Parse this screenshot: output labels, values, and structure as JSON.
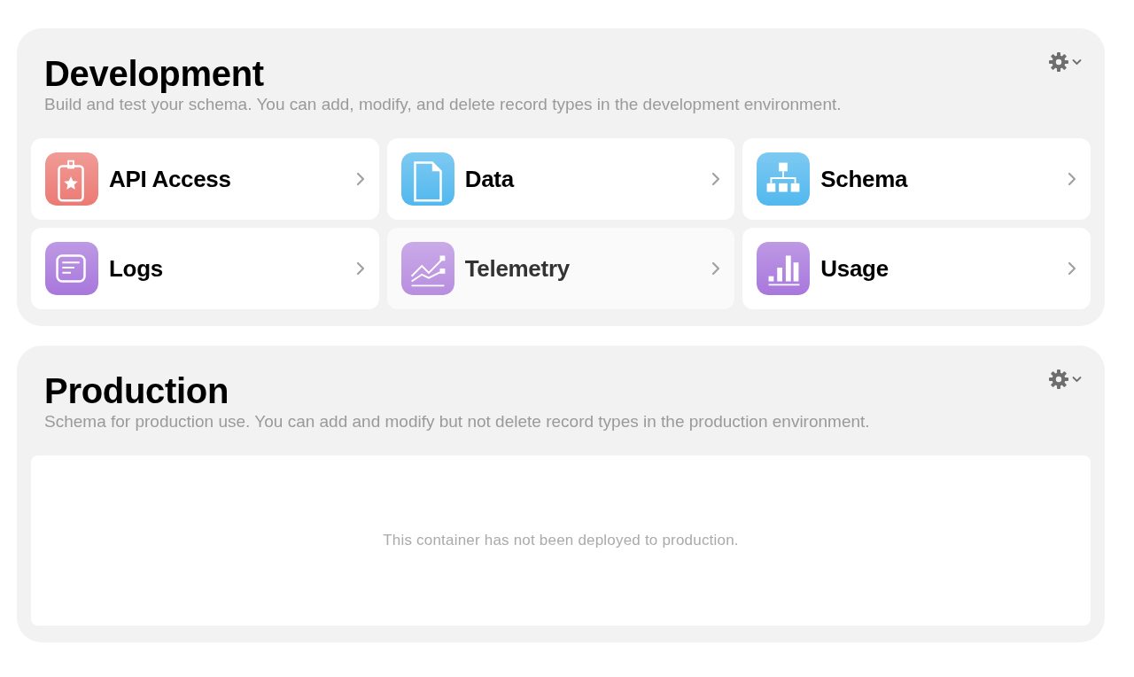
{
  "sections": [
    {
      "title": "Development",
      "subtitle": "Build and test your schema. You can add, modify, and delete record types in the development environment.",
      "tiles": [
        {
          "label": "API Access",
          "kind": "badge",
          "color": "#ec7a74",
          "highlighted": false
        },
        {
          "label": "Data",
          "kind": "document",
          "color": "#52b8ee",
          "highlighted": false
        },
        {
          "label": "Schema",
          "kind": "hierarchy",
          "color": "#52b8ee",
          "highlighted": false
        },
        {
          "label": "Logs",
          "kind": "list",
          "color": "#a877dc",
          "highlighted": false
        },
        {
          "label": "Telemetry",
          "kind": "chart",
          "color": "#b88ee0",
          "highlighted": true
        },
        {
          "label": "Usage",
          "kind": "bars",
          "color": "#a877dc",
          "highlighted": false
        }
      ]
    },
    {
      "title": "Production",
      "subtitle": "Schema for production use. You can add and modify but not delete record types in the production environment.",
      "empty_message": "This container has not been deployed to production."
    }
  ]
}
